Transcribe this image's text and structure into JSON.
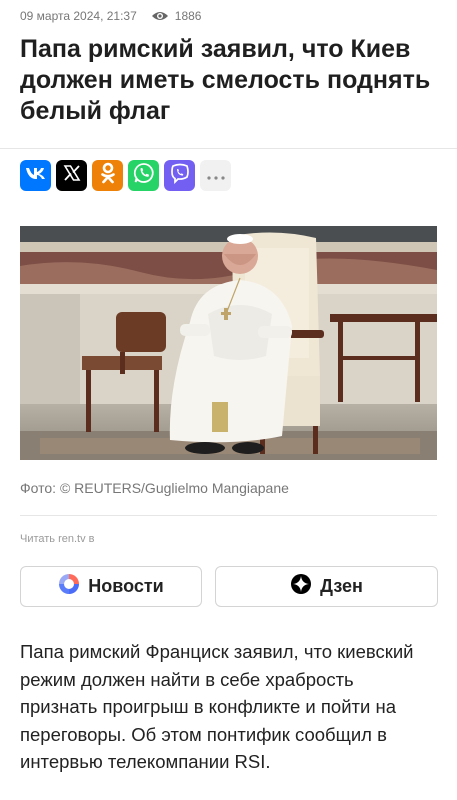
{
  "article": {
    "date": "09 марта 2024, 21:37",
    "views": "1886",
    "title": "Папа римский заявил, что Киев должен иметь смелость поднять белый флаг",
    "photo_caption": "Фото: © REUTERS/Guglielmo Mangiapane",
    "read_on": "Читать ren.tv в",
    "body": "Папа римский Франциск заявил, что киевский режим должен найти в себе храбрость признать проигрыш в конфликте и пойти на переговоры. Об этом понтифик сообщил в интервью телекомпании RSI."
  },
  "share": [
    {
      "name": "vk",
      "icon": "vk-icon",
      "color": "#0077ff",
      "label": "VK"
    },
    {
      "name": "x",
      "icon": "x-icon",
      "color": "#000000"
    },
    {
      "name": "ok",
      "icon": "odnoklassniki-icon",
      "color": "#ee8208"
    },
    {
      "name": "whatsapp",
      "icon": "whatsapp-icon",
      "color": "#25d366"
    },
    {
      "name": "viber",
      "icon": "viber-icon",
      "color": "#7360f2"
    },
    {
      "name": "more",
      "icon": "more-icon",
      "color": "#f1f1f1"
    }
  ],
  "sources": {
    "news_label": "Новости",
    "dzen_label": "Дзен"
  }
}
